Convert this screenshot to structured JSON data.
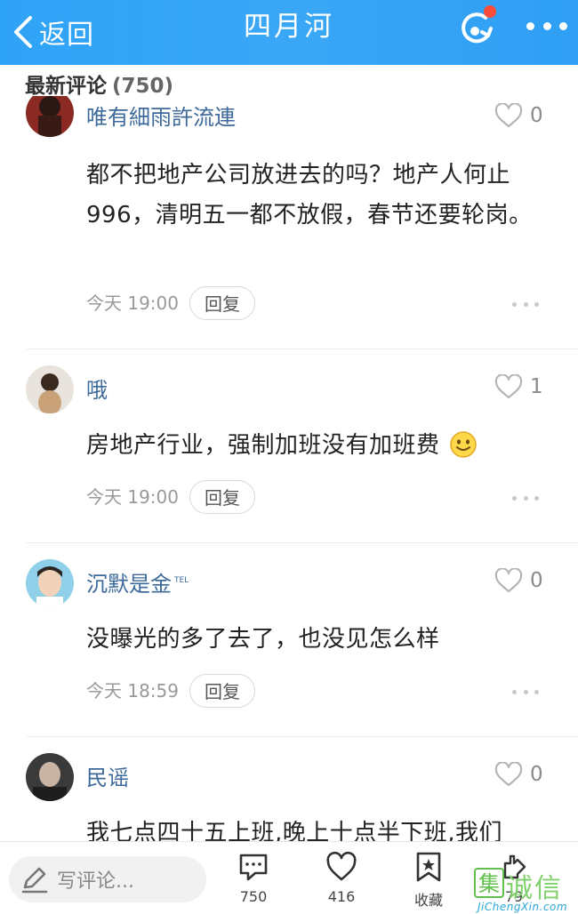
{
  "header": {
    "back_label": "返回",
    "title": "四月河"
  },
  "section": {
    "title": "最新评论",
    "count": "(750)"
  },
  "comments": [
    {
      "name": "唯有細雨許流連",
      "likes": "0",
      "text": "都不把地产公司放进去的吗？地产人何止996，清明五一都不放假，春节还要轮岗。",
      "time": "今天 19:00",
      "reply_label": "回复"
    },
    {
      "name": "哦",
      "likes": "1",
      "text": "房地产行业，强制加班没有加班费",
      "emoji": "smile-emoji",
      "time": "今天 19:00",
      "reply_label": "回复"
    },
    {
      "name": "沉默是金",
      "badge": "TEL",
      "likes": "0",
      "text": "没曝光的多了去了，也没见怎么样",
      "time": "今天 18:59",
      "reply_label": "回复"
    },
    {
      "name": "民谣",
      "likes": "0",
      "text": "我七点四十五上班,晚上十点半下班,我们"
    }
  ],
  "bottom": {
    "write_placeholder": "写评论...",
    "comments_count": "750",
    "likes_count": "416",
    "favorite_label": "收藏",
    "share_count": "79"
  },
  "watermark": {
    "mark": "集",
    "text": "诚信",
    "url": "JiChengXin.com"
  },
  "colors": {
    "header_bg": "#34a3f6",
    "name": "#3d6a9a",
    "badge": "#ff4d3a"
  }
}
